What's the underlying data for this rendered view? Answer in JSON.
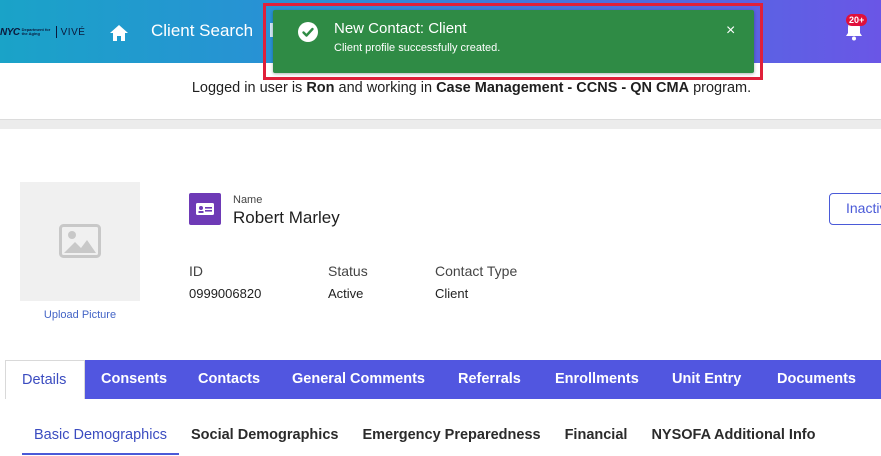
{
  "header": {
    "logo_nyc": "NYC",
    "logo_dept": "Department for the Aging",
    "logo_vive": "VIVÉ",
    "nav_search": "Client Search",
    "bell_badge": "20+"
  },
  "toast": {
    "title": "New Contact: Client",
    "message": "Client profile successfully created.",
    "close": "×",
    "outline_color": "#e0203a",
    "color": "#2f8b45"
  },
  "login": {
    "prefix": "Logged in user is ",
    "user": "Ron",
    "middle": " and working in ",
    "program": "Case Management - CCNS - QN CMA",
    "suffix": " program."
  },
  "profile": {
    "upload_label": "Upload Picture",
    "name_label": "Name",
    "name_value": "Robert Marley",
    "inactive_button": "Inactive",
    "id_label": "ID",
    "id_value": "0999006820",
    "status_label": "Status",
    "status_value": "Active",
    "contact_type_label": "Contact Type",
    "contact_type_value": "Client"
  },
  "tabs": [
    {
      "label": "Details",
      "active": true
    },
    {
      "label": "Consents"
    },
    {
      "label": "Contacts"
    },
    {
      "label": "General Comments"
    },
    {
      "label": "Referrals"
    },
    {
      "label": "Enrollments"
    },
    {
      "label": "Unit Entry"
    },
    {
      "label": "Documents"
    }
  ],
  "subtabs": [
    {
      "label": "Basic Demographics",
      "active": true
    },
    {
      "label": "Social Demographics"
    },
    {
      "label": "Emergency Preparedness"
    },
    {
      "label": "Financial"
    },
    {
      "label": "NYSOFA Additional Info"
    }
  ],
  "colors": {
    "accent": "#5156e0",
    "badge_purple": "#6e3ab6"
  }
}
